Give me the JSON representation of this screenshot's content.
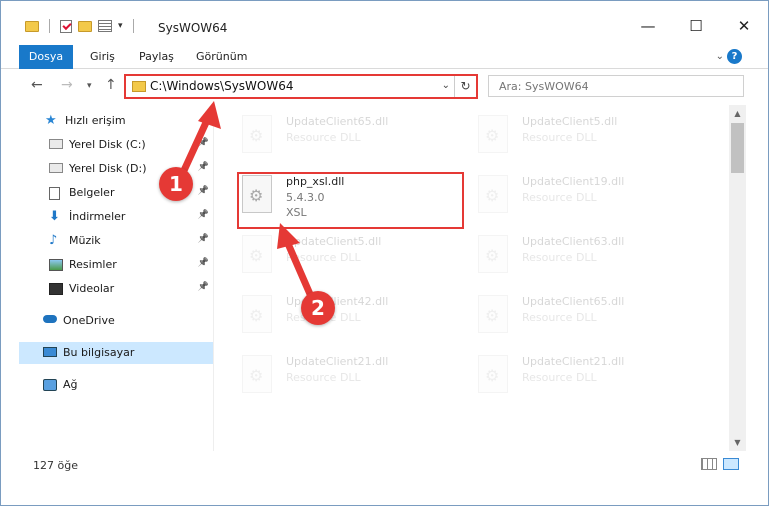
{
  "window": {
    "title": "SysWOW64",
    "controls": {
      "minimize": "—",
      "maximize": "☐",
      "close": "✕"
    }
  },
  "ribbon": {
    "tabs": [
      "Dosya",
      "Giriş",
      "Paylaş",
      "Görünüm"
    ],
    "help": "?"
  },
  "nav": {
    "address_path": "C:\\Windows\\SysWOW64",
    "search_placeholder": "Ara: SysWOW64"
  },
  "sidebar": {
    "items": [
      {
        "label": "Hızlı erişim",
        "icon": "star-icon"
      },
      {
        "label": "Yerel Disk (C:)",
        "icon": "drive-icon",
        "pinned": true
      },
      {
        "label": "Yerel Disk (D:)",
        "icon": "drive-icon",
        "pinned": true
      },
      {
        "label": "Belgeler",
        "icon": "documents-icon",
        "pinned": true
      },
      {
        "label": "İndirmeler",
        "icon": "download-icon",
        "pinned": true
      },
      {
        "label": "Müzik",
        "icon": "music-icon",
        "pinned": true
      },
      {
        "label": "Resimler",
        "icon": "pictures-icon",
        "pinned": true
      },
      {
        "label": "Videolar",
        "icon": "video-icon",
        "pinned": true
      },
      {
        "label": "OneDrive",
        "icon": "cloud-icon"
      },
      {
        "label": "Bu bilgisayar",
        "icon": "computer-icon",
        "selected": true
      },
      {
        "label": "Ağ",
        "icon": "network-icon"
      }
    ]
  },
  "files": [
    {
      "name": "UpdateClient65.dll",
      "meta1": "Resource DLL",
      "meta2": ""
    },
    {
      "name": "UpdateClient5.dll",
      "meta1": "Resource DLL",
      "meta2": ""
    },
    {
      "name": "php_xsl.dll",
      "meta1": "5.4.3.0",
      "meta2": "XSL"
    },
    {
      "name": "UpdateClient19.dll",
      "meta1": "Resource DLL",
      "meta2": ""
    },
    {
      "name": "UpdateClient5.dll",
      "meta1": "Resource DLL",
      "meta2": ""
    },
    {
      "name": "UpdateClient63.dll",
      "meta1": "Resource DLL",
      "meta2": ""
    },
    {
      "name": "UpdateClient42.dll",
      "meta1": "Resource DLL",
      "meta2": ""
    },
    {
      "name": "UpdateClient65.dll",
      "meta1": "Resource DLL",
      "meta2": ""
    },
    {
      "name": "UpdateClient21.dll",
      "meta1": "Resource DLL",
      "meta2": ""
    },
    {
      "name": "UpdateClient21.dll",
      "meta1": "Resource DLL",
      "meta2": ""
    }
  ],
  "status": {
    "item_count": "127 öğe"
  },
  "annotations": {
    "step1": "1",
    "step2": "2",
    "color": "#e53935"
  }
}
